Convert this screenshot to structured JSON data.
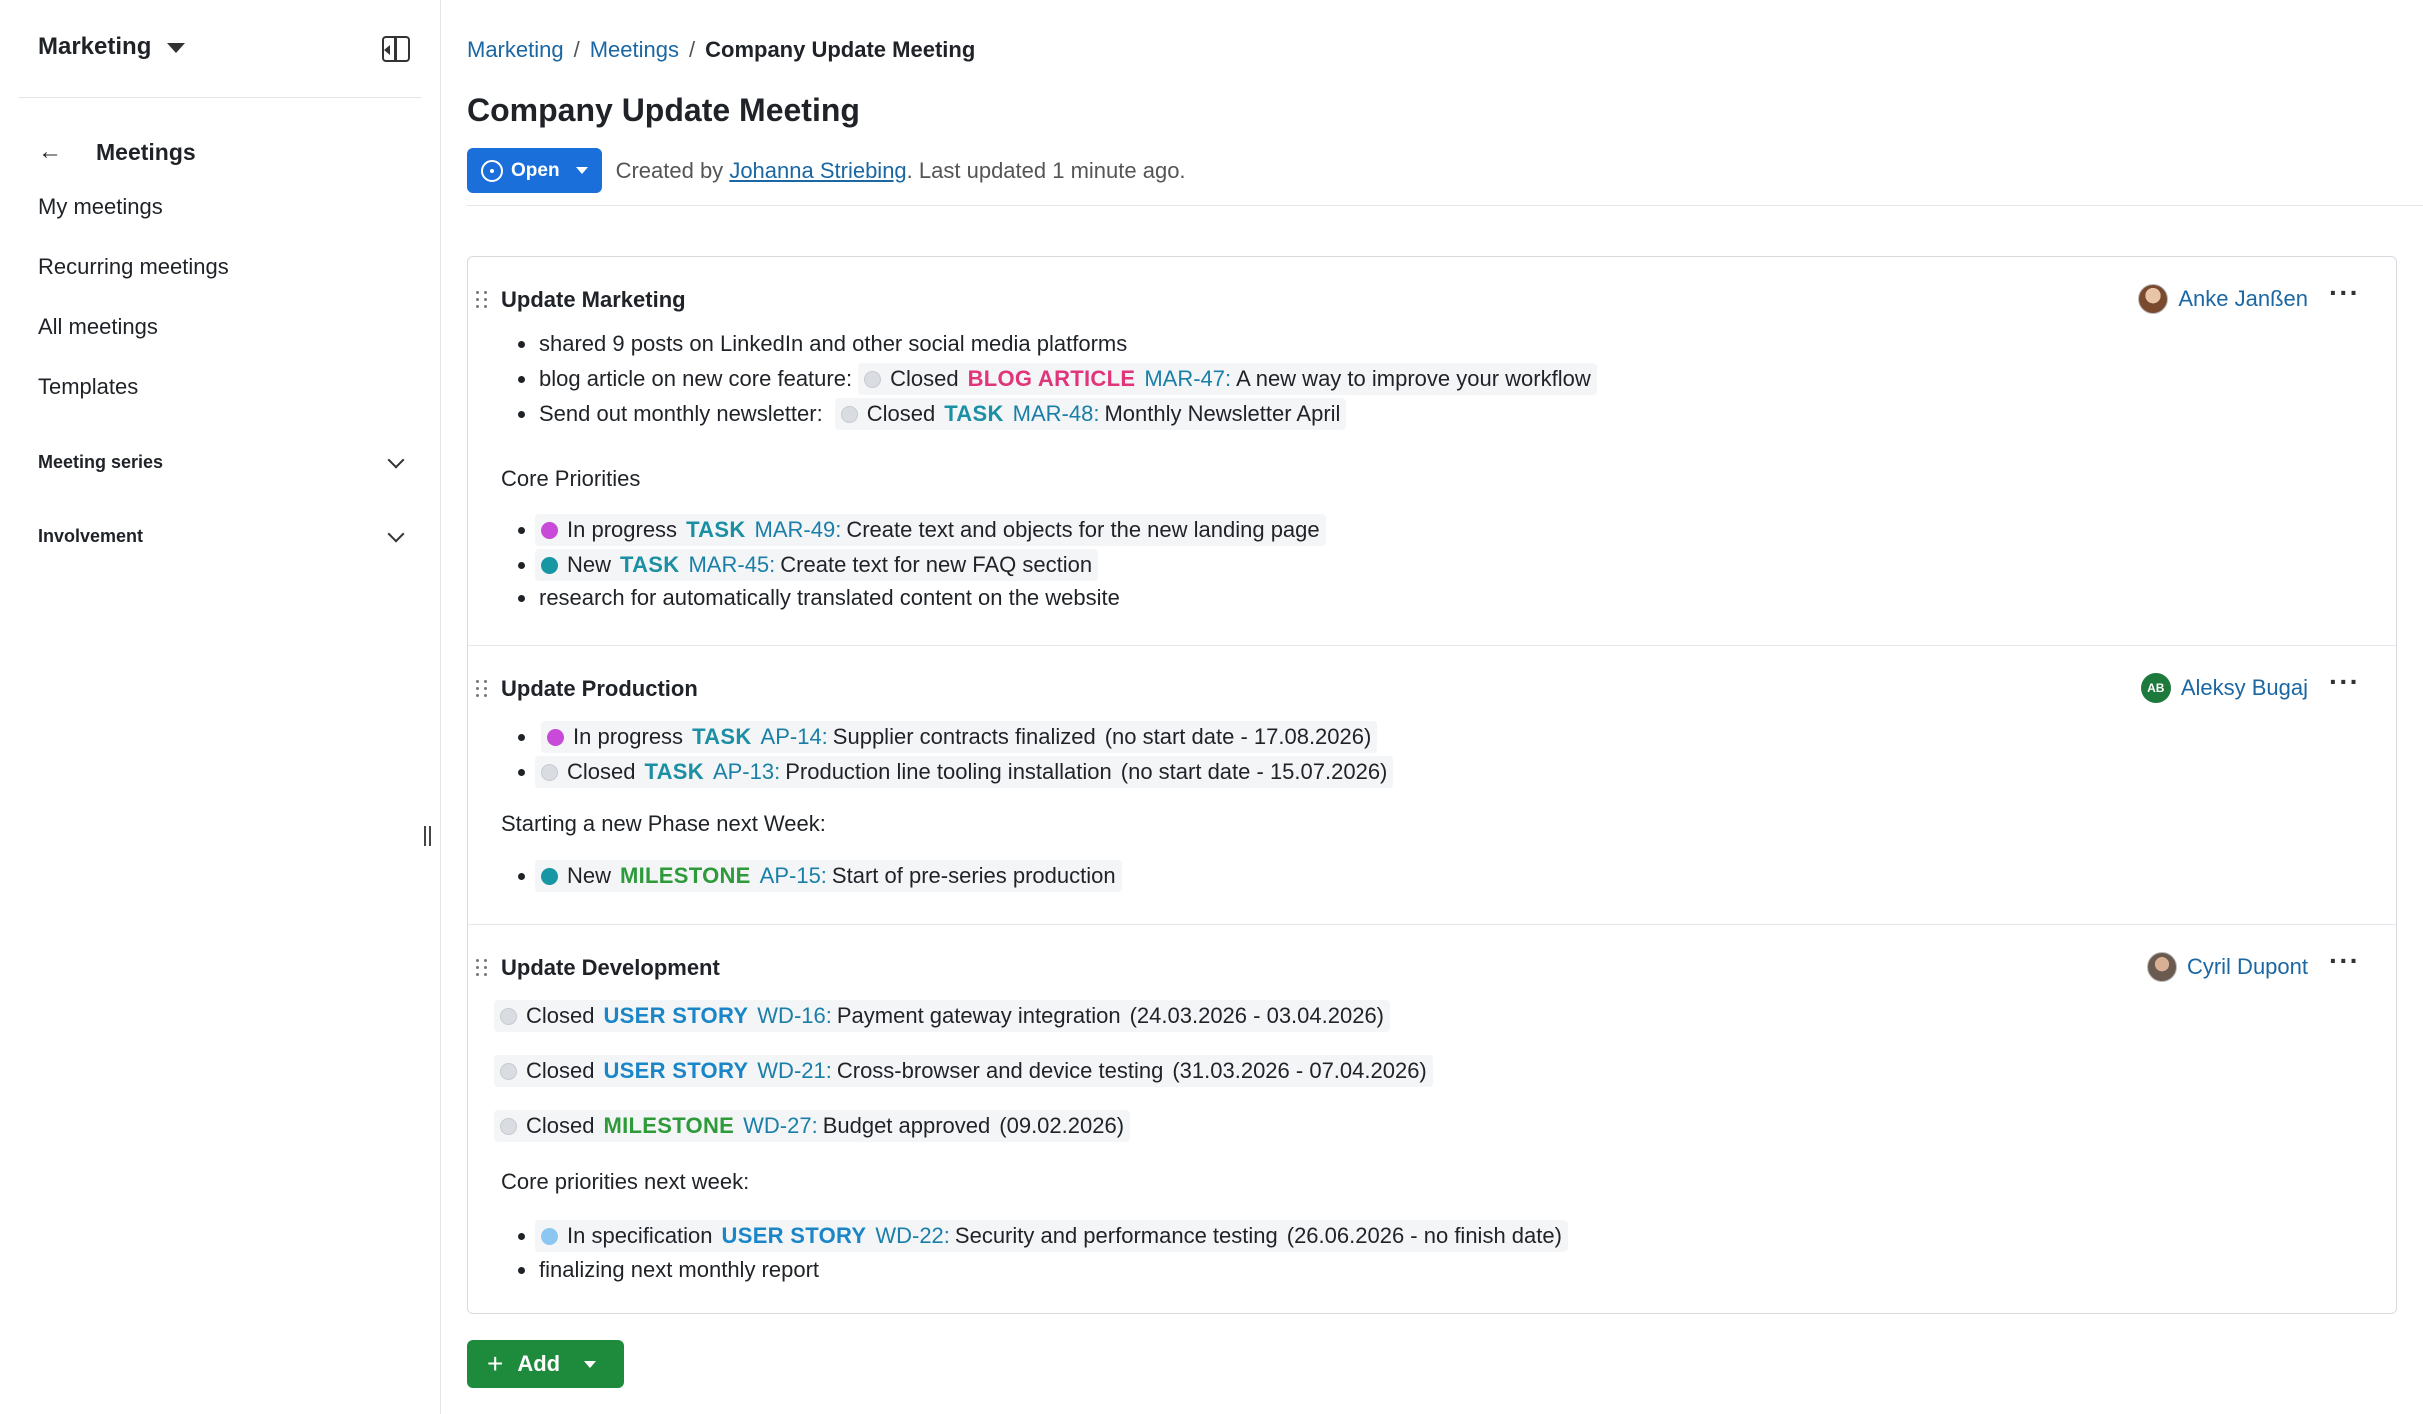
{
  "sidebar": {
    "project": "Marketing",
    "back_title": "Meetings",
    "items": [
      {
        "label": "My meetings"
      },
      {
        "label": "Recurring meetings"
      },
      {
        "label": "All meetings"
      },
      {
        "label": "Templates"
      }
    ],
    "sections": [
      {
        "label": "Meeting series"
      },
      {
        "label": "Involvement"
      }
    ]
  },
  "breadcrumb": [
    "Marketing",
    "Meetings",
    "Company Update Meeting"
  ],
  "page": {
    "title": "Company Update Meeting",
    "status": "Open",
    "created_by_prefix": "Created by",
    "author": "Johanna Striebing",
    "updated_text": ". Last updated 1 minute ago."
  },
  "colors": {
    "accent": "#1a6fdb",
    "link": "#1a67a3",
    "blog_article": "#e0357a",
    "task": "#1b8fa3",
    "milestone": "#2e9a3a",
    "user_story": "#1a86c7",
    "closed": "#d9dce0",
    "in_progress": "#c84ad8",
    "new": "#1796a4",
    "in_specification": "#8cc7f2",
    "add_button": "#1e8a3c"
  },
  "sections": [
    {
      "title": "Update Marketing",
      "presenter": "Anke Janßen",
      "lines": [
        {
          "text": "shared 9 posts on LinkedIn and other social media platforms"
        },
        {
          "text": "blog article on new core feature:",
          "status": "Closed",
          "type": "BLOG ARTICLE",
          "id": "MAR-47:",
          "subject": "A new way to improve your workflow"
        },
        {
          "text": "Send out monthly newsletter:",
          "status": "Closed",
          "type": "TASK",
          "id": "MAR-48:",
          "subject": "Monthly Newsletter April"
        },
        {
          "text": "Core Priorities"
        },
        {
          "status": "In progress",
          "type": "TASK",
          "id": "MAR-49:",
          "subject": "Create text and objects for the new landing page"
        },
        {
          "status": "New",
          "type": "TASK",
          "id": "MAR-45:",
          "subject": "Create text for new FAQ section"
        },
        {
          "text": "research for automatically translated content on the website"
        }
      ]
    },
    {
      "title": "Update Production",
      "presenter": "Aleksy Bugaj",
      "presenter_initials": "AB",
      "lines": [
        {
          "status": "In progress",
          "type": "TASK",
          "id": "AP-14:",
          "subject": "Supplier contracts finalized",
          "dates": "(no start date - 17.08.2026)"
        },
        {
          "status": "Closed",
          "type": "TASK",
          "id": "AP-13:",
          "subject": "Production line tooling installation",
          "dates": "(no start date - 15.07.2026)"
        },
        {
          "text": "Starting a new Phase next Week:"
        },
        {
          "status": "New",
          "type": "MILESTONE",
          "id": "AP-15:",
          "subject": "Start of pre-series production"
        }
      ]
    },
    {
      "title": "Update Development",
      "presenter": "Cyril Dupont",
      "lines": [
        {
          "status": "Closed",
          "type": "USER STORY",
          "id": "WD-16:",
          "subject": "Payment gateway integration",
          "dates": "(24.03.2026 - 03.04.2026)"
        },
        {
          "status": "Closed",
          "type": "USER STORY",
          "id": "WD-21:",
          "subject": "Cross-browser and device testing",
          "dates": "(31.03.2026 - 07.04.2026)"
        },
        {
          "status": "Closed",
          "type": "MILESTONE",
          "id": "WD-27:",
          "subject": "Budget approved",
          "dates": "(09.02.2026)"
        },
        {
          "text": "Core priorities next week:"
        },
        {
          "status": "In specification",
          "type": "USER STORY",
          "id": "WD-22:",
          "subject": "Security and performance testing",
          "dates": "(26.06.2026 - no finish date)"
        },
        {
          "text": "finalizing next monthly report"
        }
      ]
    }
  ],
  "add_button": {
    "label": "Add"
  }
}
